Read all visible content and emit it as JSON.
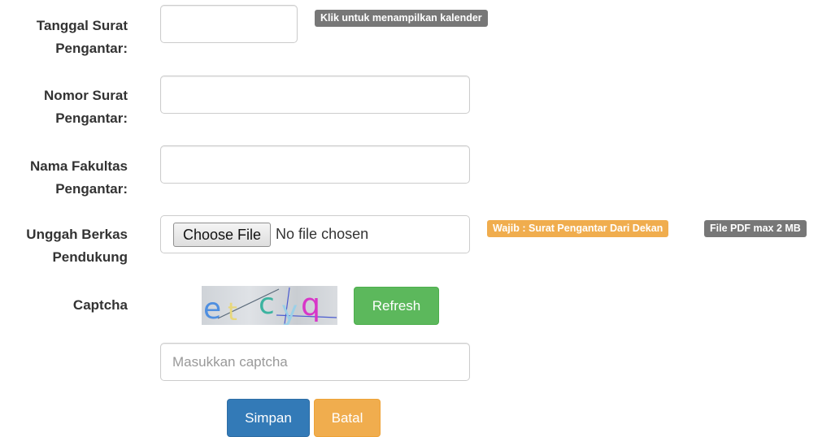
{
  "form": {
    "tanggal": {
      "label_line1": "Tanggal Surat",
      "label_line2": "Pengantar:",
      "value": "",
      "hint_badge": "Klik untuk menampilkan kalender",
      "hint_color": "#777777"
    },
    "nomor": {
      "label_line1": "Nomor Surat",
      "label_line2": "Pengantar:",
      "value": ""
    },
    "fakultas": {
      "label_line1": "Nama Fakultas",
      "label_line2": "Pengantar:",
      "value": ""
    },
    "berkas": {
      "label_line1": "Unggah Berkas",
      "label_line2": "Pendukung",
      "choose_button": "Choose File",
      "status_text": "No file chosen",
      "required_badge": "Wajib : Surat Pengantar Dari Dekan",
      "required_color": "#f0ad4e",
      "format_badge": "File PDF max 2 MB",
      "format_color": "#777777"
    },
    "captcha": {
      "label": "Captcha",
      "image_text": "etcyq",
      "refresh_button": "Refresh",
      "refresh_color": "#5cb85c",
      "input_placeholder": "Masukkan captcha",
      "input_value": ""
    },
    "actions": {
      "save_label": "Simpan",
      "save_color": "#337ab7",
      "cancel_label": "Batal",
      "cancel_color": "#f0ad4e"
    }
  }
}
